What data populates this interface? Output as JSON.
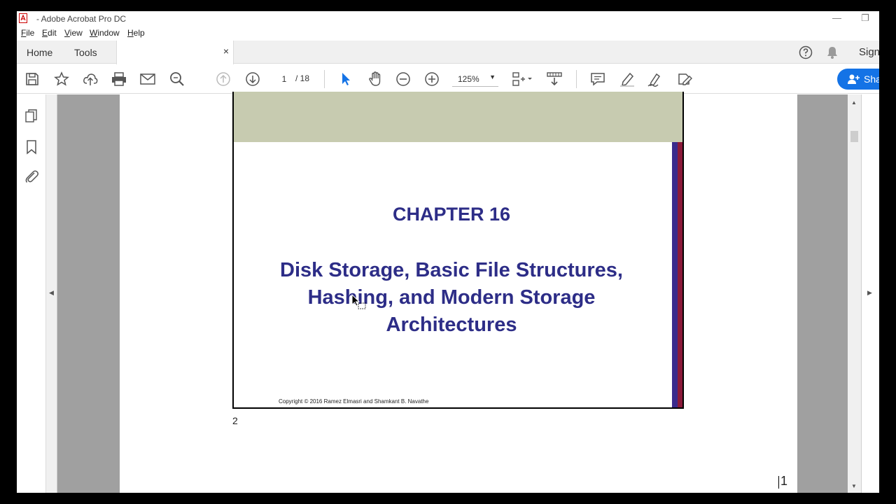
{
  "window": {
    "title": "- Adobe Acrobat Pro DC",
    "minimize_glyph": "—",
    "restore_glyph": "❐"
  },
  "menu": [
    "File",
    "Edit",
    "View",
    "Window",
    "Help"
  ],
  "tabs": {
    "home": "Home",
    "tools": "Tools",
    "close_glyph": "×",
    "sign": "Sign"
  },
  "toolbar": {
    "page_current": "1",
    "page_total": "/ 18",
    "zoom": "125%",
    "zoom_caret": "▼",
    "share": "Share"
  },
  "document": {
    "chapter": "CHAPTER 16",
    "title_lines": [
      "Disk Storage, Basic File Structures,",
      "Hashing, and Modern Storage",
      "Architectures"
    ],
    "copyright": "Copyright © 2016 Ramez Elmasri and Shamkant B. Navathe",
    "slide_number": "2",
    "page_corner_number": "1"
  },
  "colors": {
    "heading": "#2d2d87",
    "band": "#c7cbb0",
    "accent_blue": "#3a2a8c",
    "accent_red": "#8b1a3a",
    "share_button": "#1473e6"
  },
  "icons": {
    "left_collapse": "◀",
    "right_collapse": "▶",
    "scroll_up": "▲",
    "scroll_down": "▼"
  }
}
